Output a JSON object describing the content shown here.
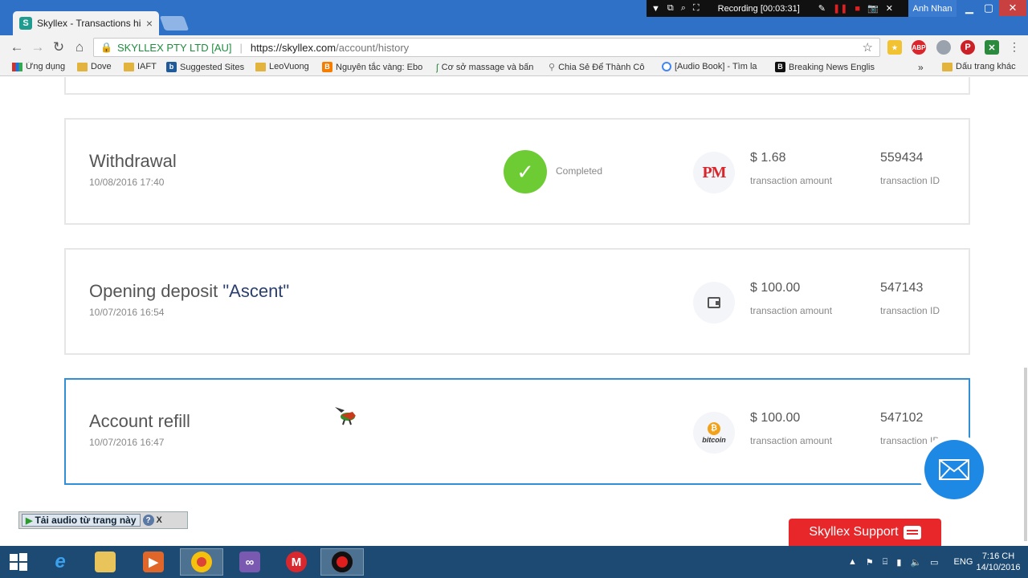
{
  "browser": {
    "tab_title": "Skyllex - Transactions his",
    "tab_close": "×",
    "favicon_glyph": "S",
    "recorder": {
      "status": "Recording [00:03:31]",
      "user": "Anh Nhan"
    },
    "nav": {
      "back": "←",
      "forward": "→",
      "reload": "↻",
      "home": "⌂"
    },
    "address": {
      "lock": "🔒",
      "secure_label": "SKYLLEX PTY LTD [AU]",
      "separator": "|",
      "url_scheme_host": "https://skyllex.com",
      "url_path": "/account/history",
      "star": "☆"
    },
    "bookmarks": [
      {
        "label": "Ứng dụng",
        "icon": "apps-grid-icon"
      },
      {
        "label": "Dove",
        "icon": "folder-icon"
      },
      {
        "label": "IAFT",
        "icon": "folder-icon"
      },
      {
        "label": "Suggested Sites",
        "icon": "bing-icon"
      },
      {
        "label": "LeoVuong",
        "icon": "folder-icon"
      },
      {
        "label": "Nguyên tắc vàng: Ebo",
        "icon": "blogger-icon"
      },
      {
        "label": "Cơ sở massage và bấn",
        "icon": "leaf-icon"
      },
      {
        "label": "Chia Sẻ Để Thành Cô",
        "icon": "link-icon"
      },
      {
        "label": "[Audio Book] - Tìm la",
        "icon": "chrome-icon"
      },
      {
        "label": "Breaking News Englis",
        "icon": "b-icon"
      }
    ],
    "bookmarks_more": "»",
    "other_bookmarks": "Dấu trang khác"
  },
  "transactions": [
    {
      "title": "Withdrawal",
      "title_highlight": "",
      "date": "10/08/2016 17:40",
      "status": "Completed",
      "status_glyph": "✓",
      "method": "perfect-money",
      "method_text": "PM",
      "amount": "$ 1.68",
      "amount_label": "transaction amount",
      "id": "559434",
      "id_label": "transaction ID"
    },
    {
      "title": "Opening deposit ",
      "title_highlight": "\"Ascent\"",
      "date": "10/07/2016 16:54",
      "status": "",
      "method": "wallet",
      "amount": "$ 100.00",
      "amount_label": "transaction amount",
      "id": "547143",
      "id_label": "transaction ID"
    },
    {
      "title": "Account refill",
      "title_highlight": "",
      "date": "10/07/2016 16:47",
      "status": "",
      "method": "bitcoin",
      "method_text": "bitcoin",
      "coin_glyph": "₿",
      "amount": "$ 100.00",
      "amount_label": "transaction amount",
      "id": "547102",
      "id_label": "transaction ID"
    }
  ],
  "audio_toolbar": {
    "label": "Tải audio từ trang này",
    "play": "▶",
    "help": "?",
    "close": "X"
  },
  "support": {
    "label": "Skyllex Support"
  },
  "taskbar": {
    "tray_lang": "ENG",
    "time": "7:16 CH",
    "date": "14/10/2016"
  },
  "colors": {
    "accent": "#1e88e5",
    "completed": "#6dcc33",
    "support": "#e8272b",
    "active_border": "#2f8fd8"
  }
}
